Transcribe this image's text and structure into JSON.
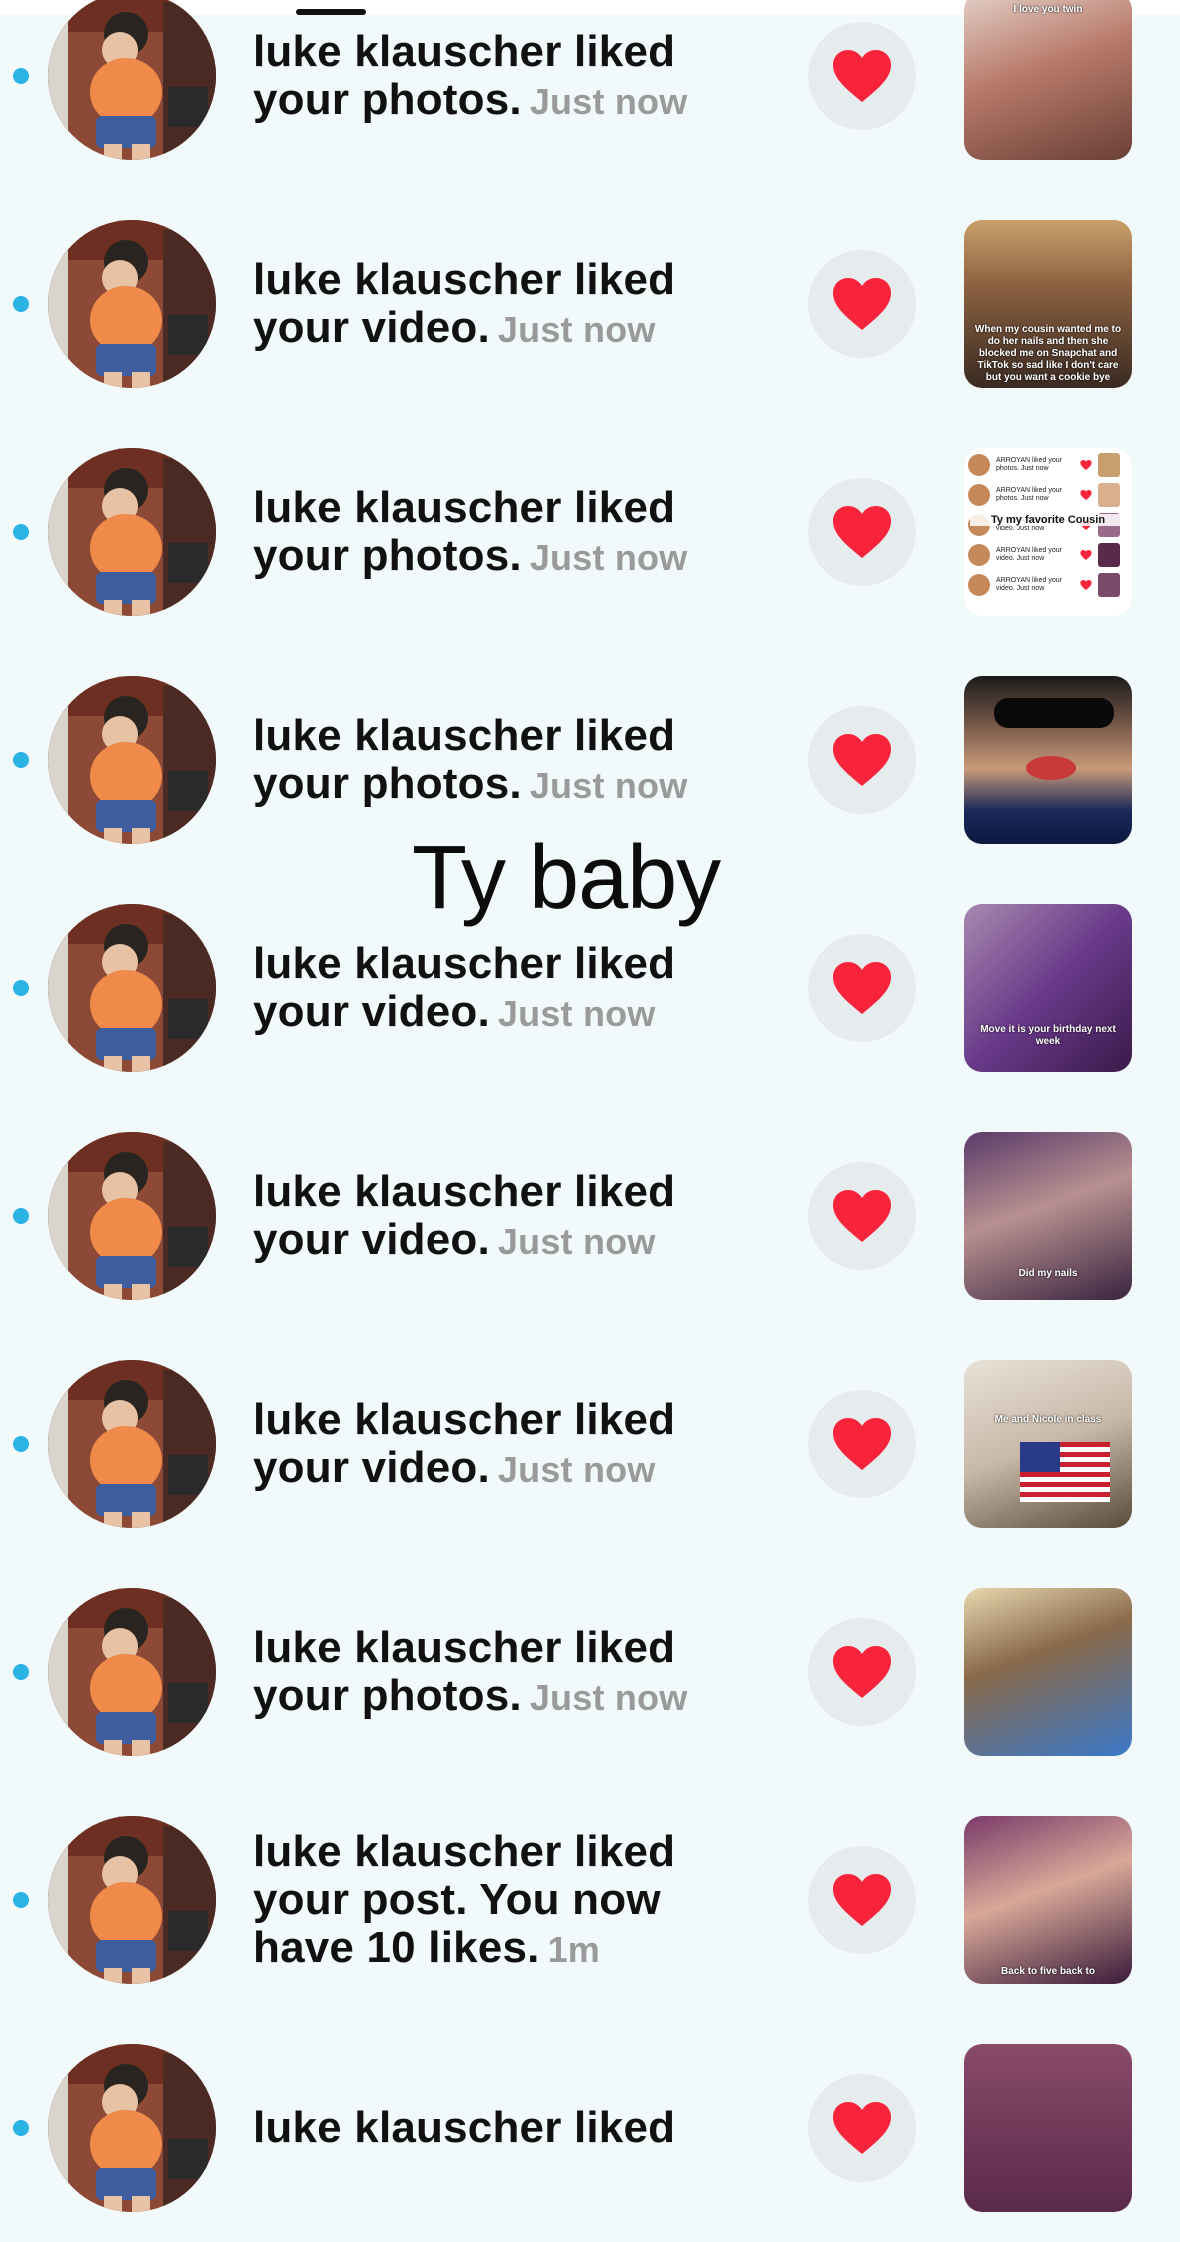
{
  "overlay_text": "Ty baby",
  "colors": {
    "unread_dot": "#2bb3e6",
    "heart": "#f8243c",
    "heart_bg": "#e6eced",
    "timestamp": "#9a9a9a"
  },
  "notifications": [
    {
      "line1": "luke klauscher liked",
      "line2": "your photos.",
      "line3": "",
      "time": "Just now",
      "thumb_caption": "I love you twin",
      "thumb_kind": "photo-twin"
    },
    {
      "line1": "luke klauscher liked",
      "line2": "your video.",
      "line3": "",
      "time": "Just now",
      "thumb_caption": "When my cousin wanted me to do her nails and then she blocked me on Snapchat and TikTok so sad like I don't care but you want a cookie bye",
      "thumb_kind": "video-selfie"
    },
    {
      "line1": "luke klauscher liked",
      "line2": "your photos.",
      "line3": "",
      "time": "Just now",
      "thumb_caption": "Ty my favorite Cousin",
      "thumb_kind": "screenshot-list"
    },
    {
      "line1": "luke klauscher liked",
      "line2": "your photos.",
      "line3": "",
      "time": "Just now",
      "thumb_caption": "",
      "thumb_kind": "sunglasses"
    },
    {
      "line1": "luke klauscher liked",
      "line2": "your video.",
      "line3": "",
      "time": "Just now",
      "thumb_caption": "Move it is your birthday next week",
      "thumb_kind": "purple-room"
    },
    {
      "line1": "luke klauscher liked",
      "line2": "your video.",
      "line3": "",
      "time": "Just now",
      "thumb_caption": "Did my nails",
      "thumb_kind": "nails"
    },
    {
      "line1": "luke klauscher liked",
      "line2": "your video.",
      "line3": "",
      "time": "Just now",
      "thumb_caption": "Me and Nicole in class",
      "thumb_kind": "class-flag"
    },
    {
      "line1": "luke klauscher liked",
      "line2": "your photos.",
      "line3": "",
      "time": "Just now",
      "thumb_caption": "",
      "thumb_kind": "room-selfie"
    },
    {
      "line1": "luke klauscher liked",
      "line2": "your post. You now",
      "line3": "have 10 likes.",
      "time": "1m",
      "thumb_caption": "Back to five back to",
      "thumb_kind": "closeup"
    },
    {
      "line1": "luke klauscher liked",
      "line2": "",
      "line3": "",
      "time": "",
      "thumb_caption": "",
      "thumb_kind": "partial"
    }
  ],
  "mini_list": [
    {
      "text": "ARROYAN liked your photos. Just now"
    },
    {
      "text": "ARROYAN liked your photos. Just now"
    },
    {
      "text": "ARROYAN liked your video. Just now"
    },
    {
      "text": "ARROYAN liked your video. Just now"
    },
    {
      "text": "ARROYAN liked your video. Just now"
    }
  ]
}
